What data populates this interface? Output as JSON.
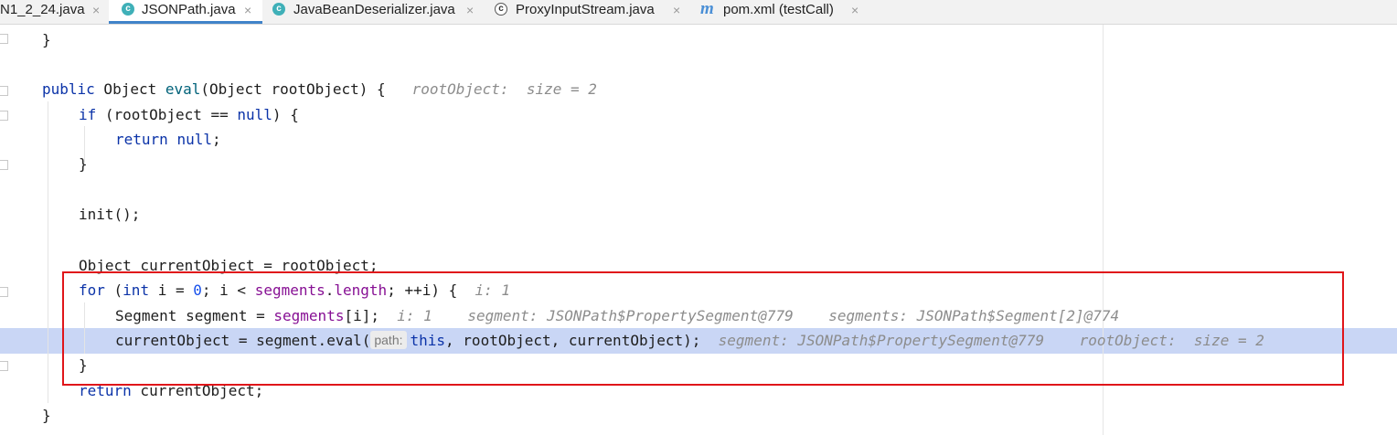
{
  "tabs": [
    {
      "label": "N1_2_24.java",
      "icon": "none",
      "active": false
    },
    {
      "label": "JSONPath.java",
      "icon": "class-icon",
      "active": true
    },
    {
      "label": "JavaBeanDeserializer.java",
      "icon": "class-icon",
      "active": false
    },
    {
      "label": "ProxyInputStream.java",
      "icon": "locked-class-icon",
      "active": false
    },
    {
      "label": "pom.xml (testCall)",
      "icon": "maven-icon",
      "active": false
    }
  ],
  "tab_close": "×",
  "icon_glyphs": {
    "class": "c",
    "maven": "m"
  },
  "code": {
    "l1": {
      "brace": "}"
    },
    "l2": {
      "kw_public": "public",
      "t1": " Object ",
      "method": "eval",
      "t2": "(Object rootObject) {",
      "hint": "rootObject:  size = 2"
    },
    "l3": {
      "kw_if": "if",
      "t1": " (rootObject == ",
      "kw_null": "null",
      "t2": ") {"
    },
    "l4": {
      "kw_return": "return",
      "t1": " ",
      "kw_null": "null",
      "t2": ";"
    },
    "l5": {
      "brace": "}"
    },
    "l6": {
      "text": "init();"
    },
    "l7": {
      "text": "Object currentObject = rootObject;"
    },
    "l8": {
      "kw_for": "for",
      "t1": " (",
      "kw_int": "int",
      "t2": " i = ",
      "num0": "0",
      "t3": "; i < ",
      "fld": "segments",
      "t4": ".",
      "fld2": "length",
      "t5": "; ++i) {",
      "hint": "i: 1"
    },
    "l9": {
      "t1": "Segment segment = ",
      "fld": "segments",
      "t2": "[i];",
      "hint1": "i: 1",
      "hint2": "segment: JSONPath$PropertySegment@779",
      "hint3": "segments: JSONPath$Segment[2]@774"
    },
    "l10": {
      "t1": "currentObject = segment.eval(",
      "param": "path:",
      "kw_this": "this",
      "t2": ", rootObject, currentObject);",
      "hint1": "segment: JSONPath$PropertySegment@779",
      "hint2": "rootObject:  size = 2"
    },
    "l11": {
      "brace": "}"
    },
    "l12": {
      "kw_return": "return",
      "t1": " currentObject;"
    },
    "l13": {
      "brace": "}"
    }
  },
  "colors": {
    "highlight": "#c9d6f5",
    "annotation_box": "#e0161a",
    "tab_underline": "#4083c9"
  }
}
